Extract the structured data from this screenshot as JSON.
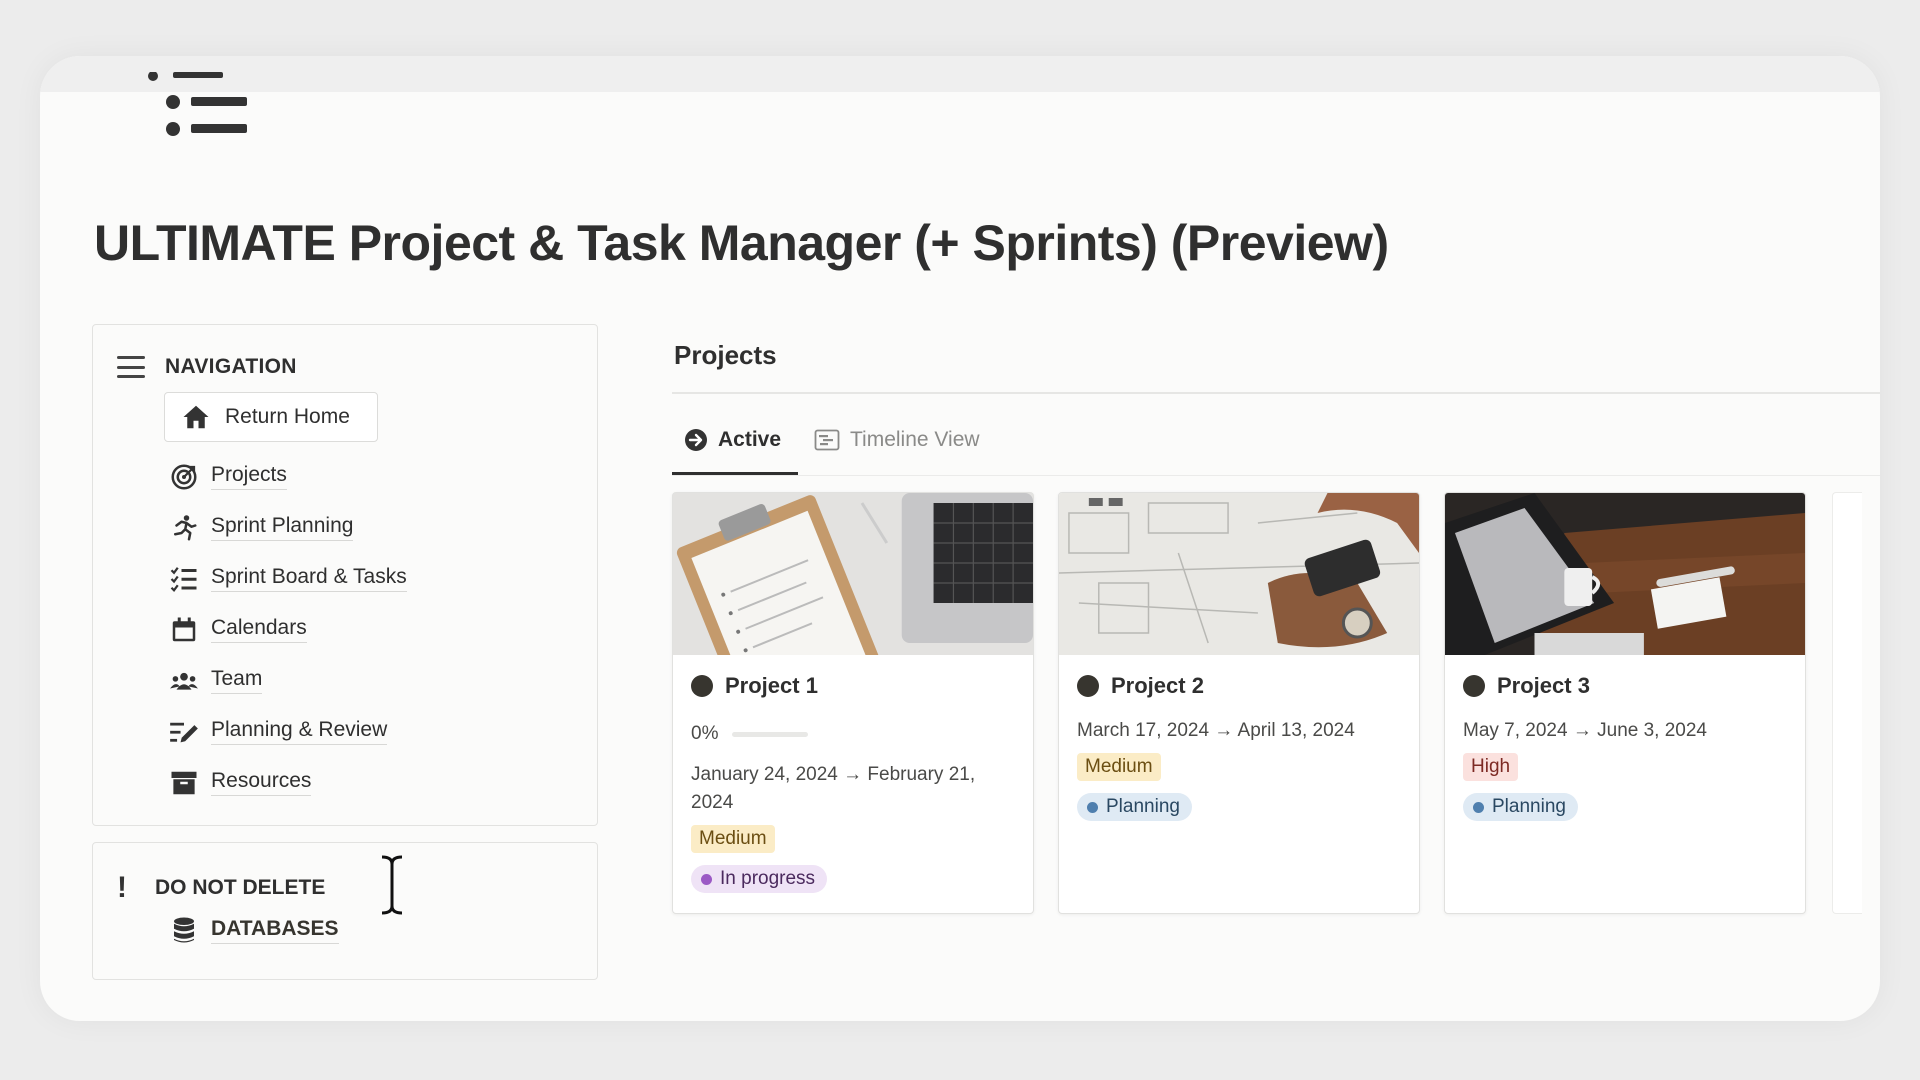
{
  "page": {
    "title": "ULTIMATE Project & Task Manager (+ Sprints) (Preview)",
    "icon": "bulleted-list-icon"
  },
  "navigation": {
    "heading": "NAVIGATION",
    "return_home": "Return Home",
    "items": [
      {
        "label": "Projects",
        "icon": "target-icon"
      },
      {
        "label": "Sprint Planning",
        "icon": "running-person-icon"
      },
      {
        "label": "Sprint Board & Tasks",
        "icon": "checklist-icon"
      },
      {
        "label": "Calendars",
        "icon": "calendar-icon"
      },
      {
        "label": "Team",
        "icon": "people-icon"
      },
      {
        "label": "Planning & Review",
        "icon": "pen-list-icon"
      },
      {
        "label": "Resources",
        "icon": "archive-box-icon"
      }
    ]
  },
  "do_not_delete": {
    "heading": "DO NOT DELETE",
    "databases": "DATABASES"
  },
  "projects": {
    "heading": "Projects",
    "tabs": [
      {
        "label": "Active",
        "icon": "arrow-circle-icon",
        "active": true
      },
      {
        "label": "Timeline View",
        "icon": "timeline-icon",
        "active": false
      }
    ],
    "cards": [
      {
        "name": "Project 1",
        "progress_label": "0%",
        "progress": 0,
        "dates": "January 24, 2024 → February 21, 2024",
        "priority": "Medium",
        "priority_color": "#fbecc6",
        "priority_text": "#6b4e12",
        "status": "In progress",
        "status_bg": "#efe3f6",
        "status_dot": "#9b59c5"
      },
      {
        "name": "Project 2",
        "dates": "March 17, 2024 → April 13, 2024",
        "priority": "Medium",
        "priority_color": "#fbecc6",
        "priority_text": "#6b4e12",
        "status": "Planning",
        "status_bg": "#dfeaf4",
        "status_dot": "#4f7fae"
      },
      {
        "name": "Project 3",
        "dates": "May 7, 2024 → June 3, 2024",
        "priority": "High",
        "priority_color": "#fbe1de",
        "priority_text": "#7d2a24",
        "status": "Planning",
        "status_bg": "#dfeaf4",
        "status_dot": "#4f7fae"
      }
    ]
  }
}
